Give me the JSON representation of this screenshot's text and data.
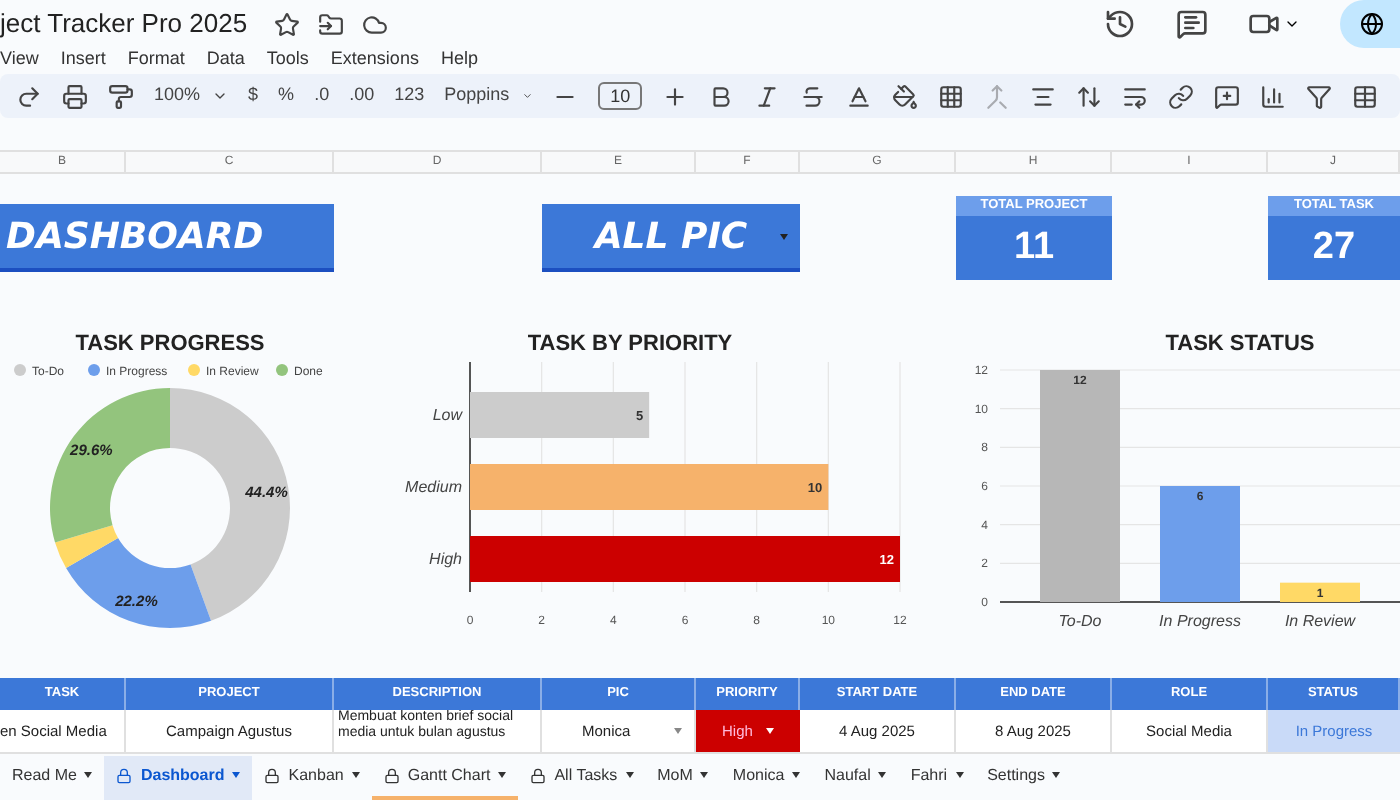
{
  "document": {
    "title": "ject Tracker Pro 2025"
  },
  "menu": [
    "View",
    "Insert",
    "Format",
    "Data",
    "Tools",
    "Extensions",
    "Help"
  ],
  "toolbar": {
    "zoom": "100%",
    "currency": "$",
    "percent": "%",
    "decrease_decimals": ".0",
    "increase_decimals": ".00",
    "number_format": "123",
    "font": "Poppins",
    "font_size": "10"
  },
  "columns": [
    "B",
    "C",
    "D",
    "E",
    "F",
    "G",
    "H",
    "I",
    "J"
  ],
  "dashboard": {
    "title": "DASHBOARD",
    "filter": "ALL PIC",
    "stats": [
      {
        "label": "TOTAL PROJECT",
        "value": "11"
      },
      {
        "label": "TOTAL TASK",
        "value": "27"
      }
    ]
  },
  "progress_chart": {
    "slices": [
      {
        "color": "#cccccc"
      },
      {
        "color": "#6d9eeb"
      },
      {
        "color": "#ffd966"
      },
      {
        "color": "#93c47d"
      }
    ],
    "chart_data": {
      "type": "donut",
      "title": "TASK PROGRESS",
      "legend": "top",
      "categories": [
        "To-Do",
        "In Progress",
        "In Review",
        "Done"
      ],
      "values": [
        44.4,
        22.2,
        3.7,
        29.6
      ],
      "value_labels": [
        "44.4%",
        "22.2%",
        null,
        "29.6%"
      ]
    }
  },
  "priority_chart": {
    "bars": [
      {
        "color": "#cccccc"
      },
      {
        "color": "#f6b26b"
      },
      {
        "color": "#cc0000"
      }
    ],
    "chart_data": {
      "type": "bar",
      "orientation": "horizontal",
      "title": "TASK BY PRIORITY",
      "grid": true,
      "categories": [
        "Low",
        "Medium",
        "High"
      ],
      "values": [
        5,
        10,
        12
      ],
      "xlim": [
        0,
        12
      ],
      "xticks": [
        0,
        2,
        4,
        6,
        8,
        10,
        12
      ],
      "data_labels": true
    }
  },
  "status_chart": {
    "bars": [
      {
        "color": "#b7b7b7"
      },
      {
        "color": "#6d9eeb"
      },
      {
        "color": "#ffd966"
      }
    ],
    "chart_data": {
      "type": "bar",
      "orientation": "vertical",
      "title": "TASK STATUS",
      "grid": true,
      "categories": [
        "To-Do",
        "In Progress",
        "In Review"
      ],
      "values": [
        12,
        6,
        1
      ],
      "ylim": [
        0,
        12
      ],
      "yticks": [
        0,
        2,
        4,
        6,
        8,
        10,
        12
      ],
      "data_labels": true
    }
  },
  "table": {
    "columns": [
      "TASK",
      "PROJECT",
      "DESCRIPTION",
      "PIC",
      "PRIORITY",
      "START DATE",
      "END DATE",
      "ROLE",
      "STATUS"
    ],
    "rows": [
      {
        "task": "en Social Media",
        "project": "Campaign Agustus",
        "description": "Membuat konten brief social media untuk bulan agustus",
        "pic": "Monica",
        "priority": {
          "label": "High",
          "color": "#cc0000"
        },
        "start_date": "4 Aug 2025",
        "end_date": "8 Aug 2025",
        "role": "Social Media",
        "status": {
          "label": "In Progress",
          "color": "#c9daf8"
        }
      }
    ]
  },
  "sheet_tabs": [
    {
      "label": "Read Me",
      "locked": false,
      "selected": false
    },
    {
      "label": "Dashboard",
      "locked": true,
      "selected": true
    },
    {
      "label": "Kanban",
      "locked": true,
      "selected": false
    },
    {
      "label": "Gantt Chart",
      "locked": true,
      "selected": false,
      "color": "#f6b26b"
    },
    {
      "label": "All Tasks",
      "locked": true,
      "selected": false
    },
    {
      "label": "MoM",
      "locked": false,
      "selected": false
    },
    {
      "label": "Monica",
      "locked": false,
      "selected": false
    },
    {
      "label": "Naufal",
      "locked": false,
      "selected": false
    },
    {
      "label": "Fahri",
      "locked": false,
      "selected": false
    },
    {
      "label": "Settings",
      "locked": false,
      "selected": false
    }
  ]
}
